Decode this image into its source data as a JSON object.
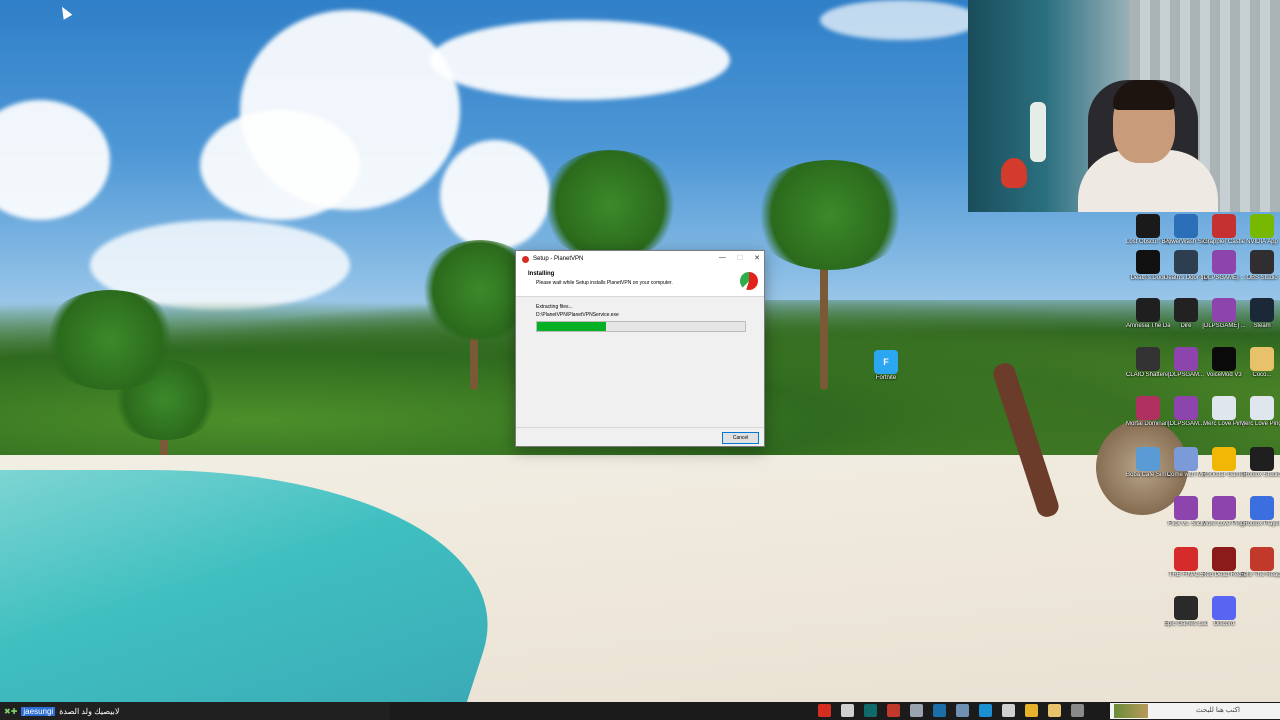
{
  "dialog": {
    "title": "Setup - PlanetVPN",
    "heading": "Installing",
    "subheading": "Please wait while Setup installs PlanetVPN on your computer.",
    "status": "Extracting files...",
    "path": "D:\\PlanetVPN\\PlanetVPNService.exe",
    "progress": 0.33,
    "cancel_label": "Cancel",
    "minimize_glyph": "—",
    "maximize_glyph": "☐",
    "close_glyph": "✕"
  },
  "desktop": {
    "icons": [
      {
        "label": "Lost Obscur: Expedition 33",
        "icon": "game-icon",
        "color": "#1a1a1a"
      },
      {
        "label": "PowerWash Simulator",
        "icon": "game-icon",
        "color": "#2b6fb8"
      },
      {
        "label": "Grappler Castle",
        "icon": "game-icon",
        "color": "#c53030"
      },
      {
        "label": "NVIDIA App",
        "icon": "nvidia-icon",
        "color": "#76b900"
      },
      {
        "label": "Death's Door",
        "icon": "game-icon",
        "color": "#111111"
      },
      {
        "label": "Death's Door Supernatural",
        "icon": "game-icon",
        "color": "#2c3e50"
      },
      {
        "label": "[DLPSGAME] ... redemption 2",
        "icon": "archive-icon",
        "color": "#8e44ad"
      },
      {
        "label": "OBS Studio",
        "icon": "obs-icon",
        "color": "#302e31"
      },
      {
        "label": "Amnesia The Dark Descent",
        "icon": "game-icon",
        "color": "#1f1f1f"
      },
      {
        "label": "Dire",
        "icon": "game-icon",
        "color": "#222222"
      },
      {
        "label": "[DLPSGAME] ...",
        "icon": "archive-icon",
        "color": "#8e44ad"
      },
      {
        "label": "Steam",
        "icon": "steam-icon",
        "color": "#1b2838"
      },
      {
        "label": "CLAIO Shattered...",
        "icon": "game-icon",
        "color": "#333333"
      },
      {
        "label": "[DLPSGAM...",
        "icon": "archive-icon",
        "color": "#8e44ad"
      },
      {
        "label": "VoiceMod V3",
        "icon": "voicemod-icon",
        "color": "#0a0a0a"
      },
      {
        "label": "Coco...",
        "icon": "folder-icon",
        "color": "#e8c26a"
      },
      {
        "label": "Mortal Dominance",
        "icon": "game-icon",
        "color": "#b03060"
      },
      {
        "label": "[DLPSGAM...",
        "icon": "archive-icon",
        "color": "#8e44ad"
      },
      {
        "label": "Merc Love Ping",
        "icon": "file-icon",
        "color": "#dfe6ee"
      },
      {
        "label": "Merc Love Ping 2025",
        "icon": "file-icon",
        "color": "#dfe6ee"
      },
      {
        "label": "Boba Cafe Simulator",
        "icon": "game-icon",
        "color": "#5b9bd5"
      },
      {
        "label": "Come with Me",
        "icon": "game-icon",
        "color": "#7a9bd8"
      },
      {
        "label": "Rockstar Games",
        "icon": "rockstar-icon",
        "color": "#f2b705"
      },
      {
        "label": "Roblox Studio",
        "icon": "roblox-studio-icon",
        "color": "#1f1f1f"
      },
      {
        "label": "Flick vs. Slick",
        "icon": "archive-icon",
        "color": "#8e44ad"
      },
      {
        "label": "More Love Ping...",
        "icon": "archive-icon",
        "color": "#8e44ad"
      },
      {
        "label": "Roblox Player",
        "icon": "roblox-icon",
        "color": "#3b6fe0"
      },
      {
        "label": "THE FINALS",
        "icon": "game-icon",
        "color": "#d52b2b"
      },
      {
        "label": "Red Dead Redempti...",
        "icon": "game-icon",
        "color": "#8b1a1a"
      },
      {
        "label": "Felix The Reaper",
        "icon": "game-icon",
        "color": "#c0392b"
      },
      {
        "label": "Epic Games Launcher",
        "icon": "epic-icon",
        "color": "#2a2a2a"
      },
      {
        "label": "Discord",
        "icon": "discord-icon",
        "color": "#5865f2"
      }
    ],
    "fortnite": {
      "label": "Fortnite",
      "icon": "fortnite-icon",
      "color": "#2aa7f0"
    }
  },
  "taskbar": {
    "chat_user": "jaesungi",
    "chat_message": "لابيصيك ولد الصدة",
    "search_placeholder": "اكتب هنا للبحث",
    "app_icons": [
      {
        "name": "planetvpn-taskbar-icon",
        "color": "#d62d20"
      },
      {
        "name": "settings-taskbar-icon",
        "color": "#cfcfcf"
      },
      {
        "name": "terminal-taskbar-icon",
        "color": "#0f6b6b"
      },
      {
        "name": "record-taskbar-icon",
        "color": "#c0392b"
      },
      {
        "name": "gear-taskbar-icon",
        "color": "#9aa4b0"
      },
      {
        "name": "steam-taskbar-icon",
        "color": "#1b6ea8"
      },
      {
        "name": "monitor-taskbar-icon",
        "color": "#6f8fb3"
      },
      {
        "name": "edge-taskbar-icon",
        "color": "#1a8fd1"
      },
      {
        "name": "window-taskbar-icon",
        "color": "#d0d0d0"
      },
      {
        "name": "chrome-taskbar-icon",
        "color": "#e8b12b"
      },
      {
        "name": "explorer-taskbar-icon",
        "color": "#e8c26a"
      },
      {
        "name": "store-taskbar-icon",
        "color": "#8a8a8a"
      }
    ]
  }
}
